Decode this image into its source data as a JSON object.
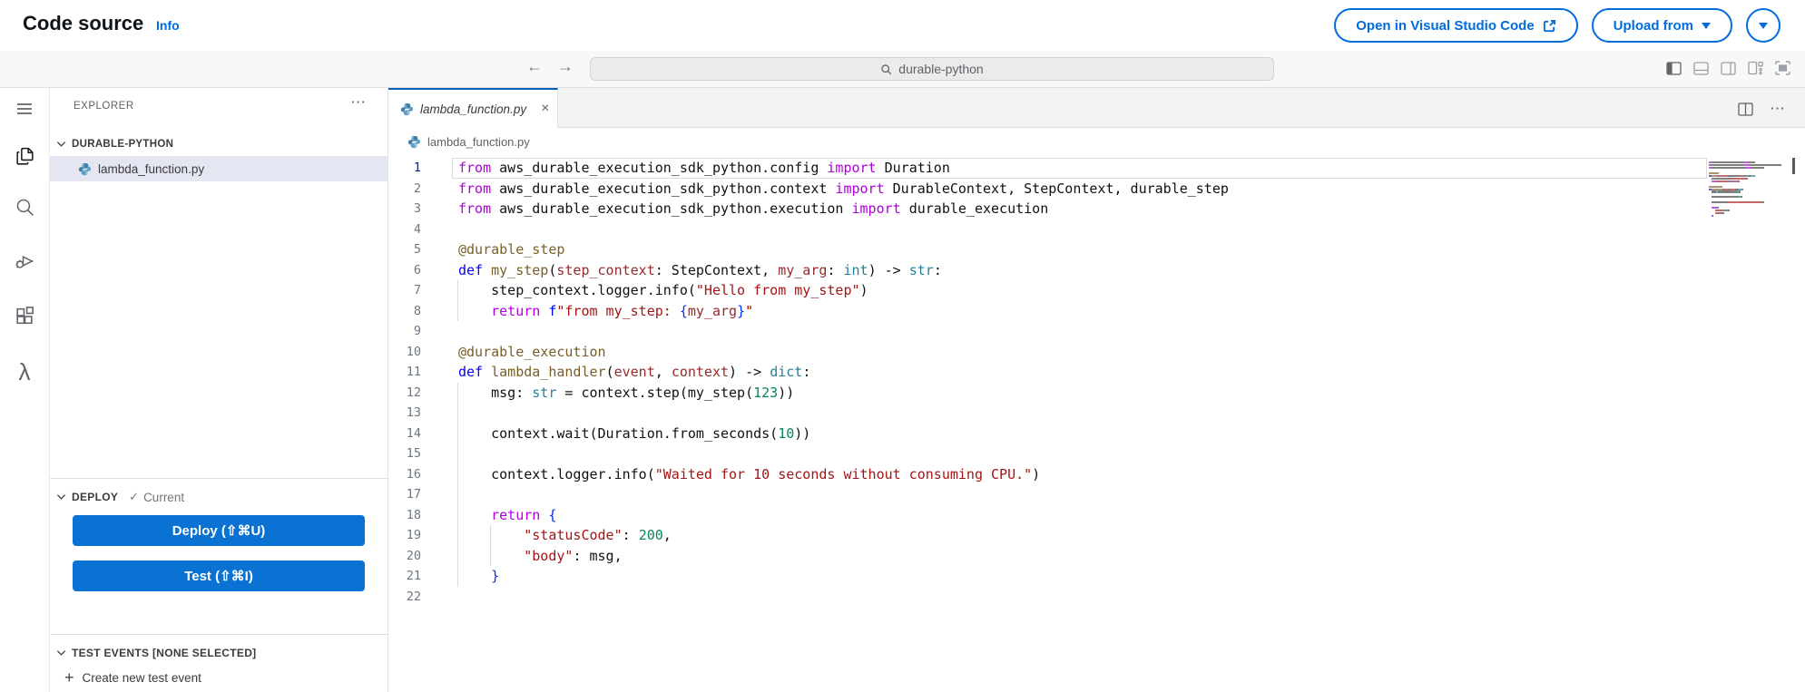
{
  "header": {
    "title": "Code source",
    "info": "Info",
    "open_vscode": "Open in Visual Studio Code",
    "upload_from": "Upload from"
  },
  "toolbar": {
    "search_value": "durable-python",
    "layout_icons": [
      "toggle-primary-sidebar",
      "toggle-panel",
      "toggle-secondary-sidebar",
      "customize-layout",
      "maximize-panel"
    ]
  },
  "activity_bar": {
    "items": [
      {
        "name": "menu-icon",
        "active": false
      },
      {
        "name": "explorer-files-icon",
        "active": true
      },
      {
        "name": "search-icon",
        "active": false
      },
      {
        "name": "run-debug-icon",
        "active": false
      },
      {
        "name": "extensions-icon",
        "active": false
      },
      {
        "name": "aws-lambda-icon",
        "active": false
      }
    ]
  },
  "sidebar": {
    "explorer_title": "EXPLORER",
    "project_name": "DURABLE-PYTHON",
    "file_name": "lambda_function.py",
    "deploy": {
      "title": "DEPLOY",
      "status": "Current",
      "deploy_button": "Deploy (⇧⌘U)",
      "test_button": "Test (⇧⌘I)"
    },
    "test_events": {
      "title": "TEST EVENTS [NONE SELECTED]",
      "create_label": "Create new test event"
    }
  },
  "editor": {
    "tab_name": "lambda_function.py",
    "breadcrumb": "lambda_function.py",
    "code": {
      "lines": [
        {
          "n": 1,
          "cur": true,
          "g": [],
          "t": [
            [
              "kw",
              "from"
            ],
            [
              "pl",
              " aws_durable_execution_sdk_python.config "
            ],
            [
              "kw",
              "import"
            ],
            [
              "pl",
              " Duration"
            ]
          ]
        },
        {
          "n": 2,
          "g": [],
          "t": [
            [
              "kw",
              "from"
            ],
            [
              "pl",
              " aws_durable_execution_sdk_python.context "
            ],
            [
              "kw",
              "import"
            ],
            [
              "pl",
              " DurableContext, StepContext, durable_step"
            ]
          ]
        },
        {
          "n": 3,
          "g": [],
          "t": [
            [
              "kw",
              "from"
            ],
            [
              "pl",
              " aws_durable_execution_sdk_python.execution "
            ],
            [
              "kw",
              "import"
            ],
            [
              "pl",
              " durable_execution"
            ]
          ]
        },
        {
          "n": 4,
          "g": [],
          "t": []
        },
        {
          "n": 5,
          "g": [],
          "t": [
            [
              "fn",
              "@durable_step"
            ]
          ]
        },
        {
          "n": 6,
          "g": [],
          "t": [
            [
              "def",
              "def "
            ],
            [
              "fn",
              "my_step"
            ],
            [
              "pl",
              "("
            ],
            [
              "par",
              "step_context"
            ],
            [
              "pl",
              ": StepContext, "
            ],
            [
              "par",
              "my_arg"
            ],
            [
              "pl",
              ": "
            ],
            [
              "typ",
              "int"
            ],
            [
              "pl",
              ") -> "
            ],
            [
              "typ",
              "str"
            ],
            [
              "pl",
              ":"
            ]
          ]
        },
        {
          "n": 7,
          "g": [
            0
          ],
          "t": [
            [
              "pl",
              "    step_context.logger.info("
            ],
            [
              "str",
              "\"Hello from my_step\""
            ],
            [
              "pl",
              ")"
            ]
          ]
        },
        {
          "n": 8,
          "g": [
            0
          ],
          "t": [
            [
              "pl",
              "    "
            ],
            [
              "kw",
              "return"
            ],
            [
              "pl",
              " "
            ],
            [
              "def",
              "f"
            ],
            [
              "str",
              "\"from my_step: "
            ],
            [
              "br",
              "{"
            ],
            [
              "par",
              "my_arg"
            ],
            [
              "br",
              "}"
            ],
            [
              "str",
              "\""
            ]
          ]
        },
        {
          "n": 9,
          "g": [],
          "t": []
        },
        {
          "n": 10,
          "g": [],
          "t": [
            [
              "fn",
              "@durable_execution"
            ]
          ]
        },
        {
          "n": 11,
          "g": [],
          "t": [
            [
              "def",
              "def "
            ],
            [
              "fn",
              "lambda_handler"
            ],
            [
              "pl",
              "("
            ],
            [
              "par",
              "event"
            ],
            [
              "pl",
              ", "
            ],
            [
              "par",
              "context"
            ],
            [
              "pl",
              ") -> "
            ],
            [
              "typ",
              "dict"
            ],
            [
              "pl",
              ":"
            ]
          ]
        },
        {
          "n": 12,
          "g": [
            0
          ],
          "t": [
            [
              "pl",
              "    msg: "
            ],
            [
              "typ",
              "str"
            ],
            [
              "pl",
              " = context.step(my_step("
            ],
            [
              "num",
              "123"
            ],
            [
              "pl",
              "))"
            ]
          ]
        },
        {
          "n": 13,
          "g": [
            0
          ],
          "t": []
        },
        {
          "n": 14,
          "g": [
            0
          ],
          "t": [
            [
              "pl",
              "    context.wait(Duration.from_seconds("
            ],
            [
              "num",
              "10"
            ],
            [
              "pl",
              "))"
            ]
          ]
        },
        {
          "n": 15,
          "g": [
            0
          ],
          "t": []
        },
        {
          "n": 16,
          "g": [
            0
          ],
          "t": [
            [
              "pl",
              "    context.logger.info("
            ],
            [
              "str",
              "\"Waited for 10 seconds without consuming CPU.\""
            ],
            [
              "pl",
              ")"
            ]
          ]
        },
        {
          "n": 17,
          "g": [
            0
          ],
          "t": []
        },
        {
          "n": 18,
          "g": [
            0
          ],
          "t": [
            [
              "pl",
              "    "
            ],
            [
              "kw",
              "return"
            ],
            [
              "pl",
              " "
            ],
            [
              "br",
              "{"
            ]
          ]
        },
        {
          "n": 19,
          "g": [
            0,
            4
          ],
          "t": [
            [
              "pl",
              "        "
            ],
            [
              "str",
              "\"statusCode\""
            ],
            [
              "pl",
              ": "
            ],
            [
              "num",
              "200"
            ],
            [
              "pl",
              ","
            ]
          ]
        },
        {
          "n": 20,
          "g": [
            0,
            4
          ],
          "t": [
            [
              "pl",
              "        "
            ],
            [
              "str",
              "\"body\""
            ],
            [
              "pl",
              ": msg,"
            ]
          ]
        },
        {
          "n": 21,
          "g": [
            0
          ],
          "t": [
            [
              "pl",
              "    "
            ],
            [
              "br",
              "}"
            ]
          ]
        },
        {
          "n": 22,
          "g": [],
          "t": []
        }
      ]
    }
  },
  "glyphs": {
    "more": "⋯",
    "close": "×",
    "plus": "+",
    "back": "←",
    "forward": "→",
    "check": "✓",
    "lambda": "λ"
  },
  "colors": {
    "accent": "#006ce0",
    "primary_button": "#0972d3",
    "tab_active_border": "#005fb8",
    "selection_bg": "#e4e6f1",
    "tokens": {
      "kw": "#AF00DB",
      "def": "#0000FF",
      "fn": "#795E26",
      "par": "#952A2A",
      "str": "#A31515",
      "num": "#098658",
      "typ": "#267F99",
      "br": "#0431FA",
      "pl": "#111111"
    }
  }
}
